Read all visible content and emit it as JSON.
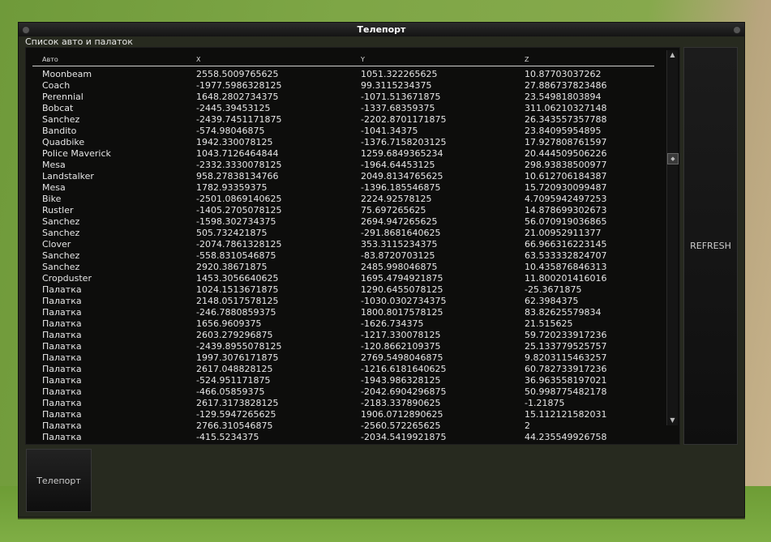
{
  "window": {
    "title": "Телепорт",
    "list_label": "Список авто и палаток"
  },
  "table": {
    "columns": [
      "Авто",
      "X",
      "Y",
      "Z"
    ],
    "rows": [
      [
        "Moonbeam",
        "2558.5009765625",
        "1051.322265625",
        "10.87703037262"
      ],
      [
        "Coach",
        "-1977.5986328125",
        "99.3115234375",
        "27.886737823486"
      ],
      [
        "Perennial",
        "1648.2802734375",
        "-1071.513671875",
        "23.54981803894"
      ],
      [
        "Bobcat",
        "-2445.39453125",
        "-1337.68359375",
        "311.06210327148"
      ],
      [
        "Sanchez",
        "-2439.7451171875",
        "-2202.8701171875",
        "26.343557357788"
      ],
      [
        "Bandito",
        "-574.98046875",
        "-1041.34375",
        "23.84095954895"
      ],
      [
        "Quadbike",
        "1942.330078125",
        "-1376.7158203125",
        "17.927808761597"
      ],
      [
        "Police Maverick",
        "1043.7126464844",
        "1259.6849365234",
        "20.444509506226"
      ],
      [
        "Mesa",
        "-2332.3330078125",
        "-1964.64453125",
        "298.93838500977"
      ],
      [
        "Landstalker",
        "958.27838134766",
        "2049.8134765625",
        "10.612706184387"
      ],
      [
        "Mesa",
        "1782.93359375",
        "-1396.185546875",
        "15.720930099487"
      ],
      [
        "Bike",
        "-2501.0869140625",
        "2224.92578125",
        "4.7095942497253"
      ],
      [
        "Rustler",
        "-1405.2705078125",
        "75.697265625",
        "14.878699302673"
      ],
      [
        "Sanchez",
        "-1598.302734375",
        "2694.947265625",
        "56.070919036865"
      ],
      [
        "Sanchez",
        "505.732421875",
        "-291.8681640625",
        "21.00952911377"
      ],
      [
        "Clover",
        "-2074.7861328125",
        "353.3115234375",
        "66.966316223145"
      ],
      [
        "Sanchez",
        "-558.8310546875",
        "-83.8720703125",
        "63.533332824707"
      ],
      [
        "Sanchez",
        "2920.38671875",
        "2485.998046875",
        "10.435876846313"
      ],
      [
        "Cropduster",
        "1453.3056640625",
        "1695.4794921875",
        "11.800201416016"
      ],
      [
        "Палатка",
        "1024.1513671875",
        "1290.6455078125",
        "-25.3671875"
      ],
      [
        "Палатка",
        "2148.0517578125",
        "-1030.0302734375",
        "62.3984375"
      ],
      [
        "Палатка",
        "-246.7880859375",
        "1800.8017578125",
        "83.82625579834"
      ],
      [
        "Палатка",
        "1656.9609375",
        "-1626.734375",
        "21.515625"
      ],
      [
        "Палатка",
        "2603.279296875",
        "-1217.330078125",
        "59.720233917236"
      ],
      [
        "Палатка",
        "-2439.8955078125",
        "-120.8662109375",
        "25.133779525757"
      ],
      [
        "Палатка",
        "1997.3076171875",
        "2769.5498046875",
        "9.8203115463257"
      ],
      [
        "Палатка",
        "2617.048828125",
        "-1216.6181640625",
        "60.782733917236"
      ],
      [
        "Палатка",
        "-524.951171875",
        "-1943.986328125",
        "36.963558197021"
      ],
      [
        "Палатка",
        "-466.05859375",
        "-2042.6904296875",
        "50.998775482178"
      ],
      [
        "Палатка",
        "2617.3173828125",
        "-2183.337890625",
        "-1.21875"
      ],
      [
        "Палатка",
        "-129.5947265625",
        "1906.0712890625",
        "15.112121582031"
      ],
      [
        "Палатка",
        "2766.310546875",
        "-2560.572265625",
        "2"
      ],
      [
        "Палатка",
        "-415.5234375",
        "-2034.5419921875",
        "44.235549926758"
      ]
    ]
  },
  "buttons": {
    "refresh": "REFRESH",
    "teleport": "Телепорт"
  },
  "scrollbar": {
    "position_fraction": 0.27
  }
}
